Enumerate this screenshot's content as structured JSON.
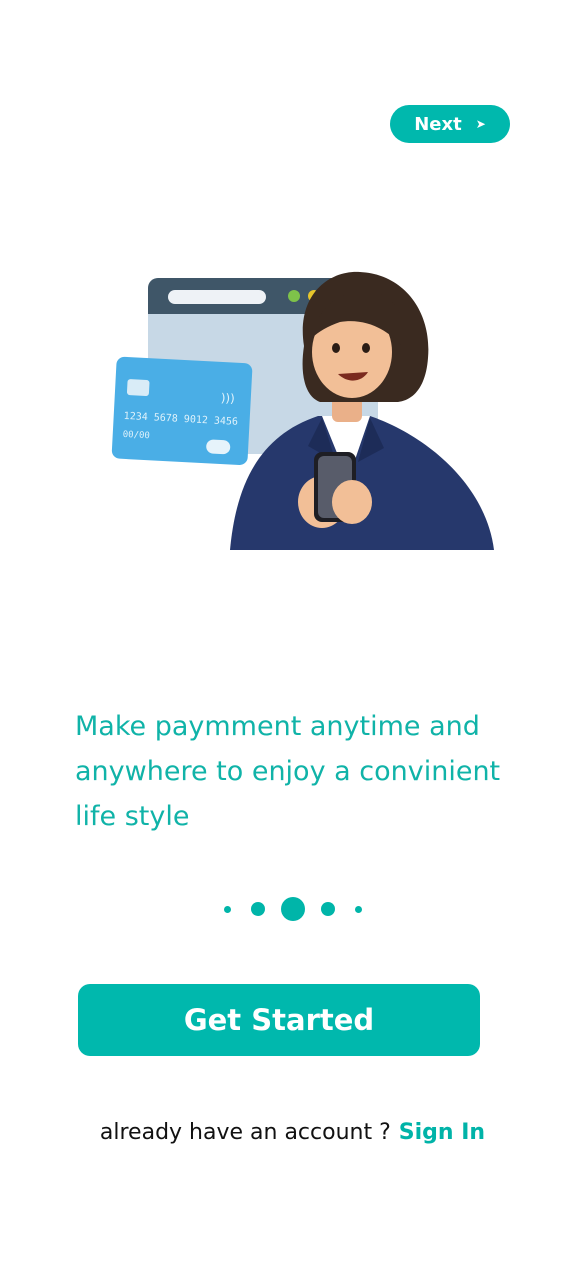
{
  "header": {
    "next_label": "Next",
    "next_icon": "arrow-right-icon"
  },
  "onboarding": {
    "headline": "Make paymment anytime and\nanywhere to enjoy  a convinient\nlife style",
    "illustration_icon": "woman-with-phone-and-card-illustration",
    "card_number": "1234 5678 9012 3456",
    "card_expiry": "00/00",
    "pagination": {
      "total": 5,
      "active": 3
    }
  },
  "actions": {
    "get_started_label": "Get Started",
    "account_prompt": "already have an account ?",
    "sign_in_label": "Sign In"
  },
  "colors": {
    "accent": "#00b8ad",
    "text": "#111111",
    "background": "#ffffff"
  }
}
